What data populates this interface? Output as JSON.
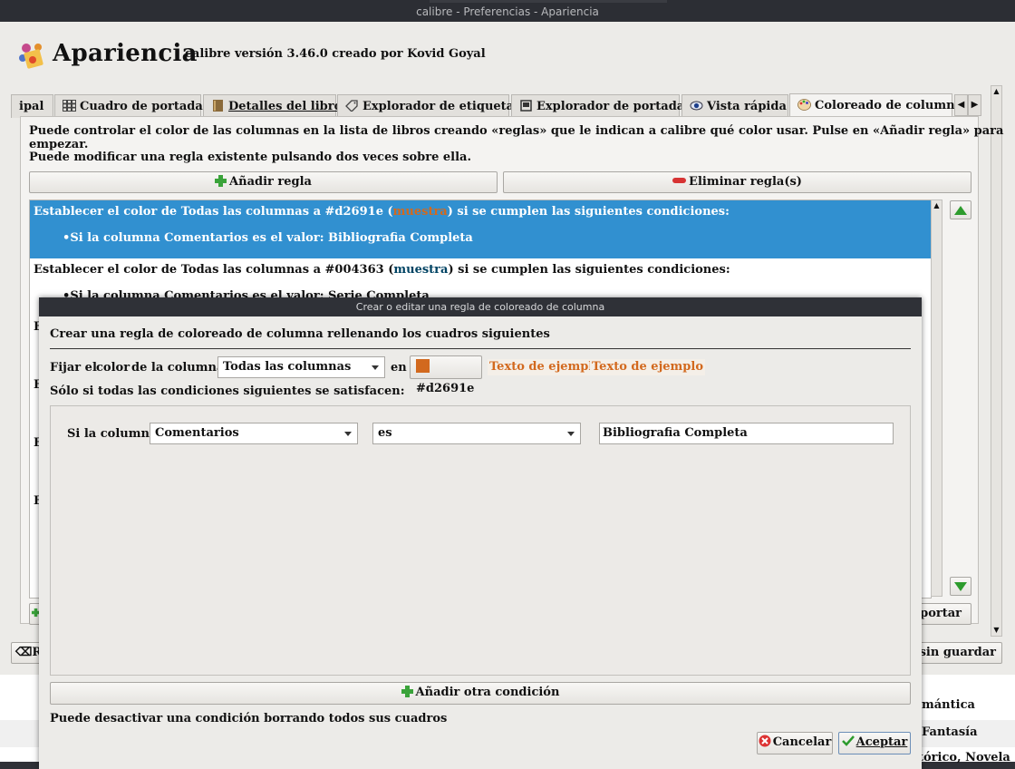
{
  "window": {
    "title": "calibre - Preferencias - Apariencia"
  },
  "header": {
    "title": "Apariencia",
    "subtitle": "calibre versión 3.46.0 creado por Kovid Goyal"
  },
  "tabs": [
    {
      "label": "ipal",
      "icon": "none"
    },
    {
      "label": "Cuadro de portadas",
      "icon": "grid-icon"
    },
    {
      "label": "Detalles del libro",
      "icon": "book-icon"
    },
    {
      "label": "Explorador de etiquetas",
      "icon": "tag-icon"
    },
    {
      "label": "Explorador de portadas",
      "icon": "cover-icon"
    },
    {
      "label": "Vista rápida",
      "icon": "eye-icon"
    },
    {
      "label": "Coloreado de columna",
      "icon": "palette-icon"
    }
  ],
  "panel": {
    "intro1": "Puede controlar el color de las columnas en la lista de libros creando «reglas» que le indican a calibre qué color usar. Pulse en «Añadir regla» para empezar.",
    "intro2": "Puede modificar una regla existente pulsando dos veces sobre ella.",
    "add_rule": "Añadir regla",
    "remove_rules": "Eliminar regla(s)",
    "rules": [
      {
        "prefix": "Establecer el color de Todas las columnas a #d2691e (",
        "sample": "muestra",
        "suffix": ") si se cumplen las siguientes condiciones:",
        "condition": "Si la columna Comentarios es el valor: Bibliografia Completa"
      },
      {
        "prefix": "Establecer el color de Todas las columnas a #004363 (",
        "sample": "muestra",
        "suffix": ") si se cumplen las siguientes condiciones:",
        "condition": "Si la columna Comentarios es el valor: Serie Completa"
      }
    ],
    "rule_letters": [
      "E",
      "E",
      "E",
      "E"
    ],
    "export_partial": "portar",
    "restore_partial": "Ro",
    "cancel_partial": "r sin guardar"
  },
  "background_list": [
    "mántica",
    "Fantasía",
    "tórico, Novela"
  ],
  "dialog": {
    "title": "Crear o editar una regla de coloreado de columna",
    "heading": "Crear una regla de coloreado de columna rellenando los cuadros siguientes",
    "set_label_1": "Fijar el",
    "set_label_2": "color",
    "set_label_3": "de la columna:",
    "column_value": "Todas las columnas",
    "en_label": "en",
    "color_value": "#d2691e",
    "color_hex": "#d2691e",
    "sample_text_1": "Texto de ejemplo",
    "sample_text_2": "Texto de ejemplo",
    "only_if": "Sólo si todas las condiciones siguientes se satisfacen:",
    "condition": {
      "label": "Si la columna",
      "column": "Comentarios",
      "operator": "es",
      "value": "Bibliografia Completa"
    },
    "add_condition": "Añadir otra condición",
    "hint": "Puede desactivar una condición borrando todos sus cuadros",
    "cancel": "Cancelar",
    "accept": "Aceptar"
  }
}
